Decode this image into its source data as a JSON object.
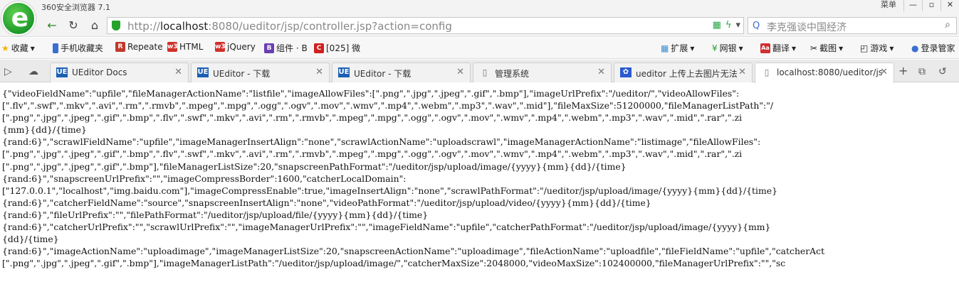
{
  "window": {
    "app_title": "360安全浏览器 7.1",
    "menu_label": "菜单",
    "controls": [
      "—",
      "▫",
      "✕"
    ]
  },
  "navbar": {
    "back_icon": "arrow-left-icon",
    "url_host": "localhost",
    "url_rest": ":8080/ueditor/jsp/controller.jsp?action=config",
    "url_scheme": "http://",
    "search_placeholder": "李克强谈中国经济"
  },
  "bookmarks": [
    {
      "label": "收藏",
      "icon": "star-icon",
      "color": "#f5b400"
    },
    {
      "label": "手机收藏夹",
      "icon": "phone-icon",
      "color": "#3b6fd0"
    },
    {
      "label": "Repeate",
      "icon": "R",
      "color": "#c0392b"
    },
    {
      "label": "HTML",
      "icon": "w3",
      "color": "#d0302b"
    },
    {
      "label": "jQuery",
      "icon": "w3",
      "color": "#d0302b"
    },
    {
      "label": "组件 · B",
      "icon": "B",
      "color": "#6a3fb1"
    },
    {
      "label": "[025] 微",
      "icon": "C",
      "color": "#d02020"
    },
    {
      "label": "扩展",
      "icon": "grid-icon",
      "color": "#3b8fd0"
    },
    {
      "label": "网银",
      "icon": "money-icon",
      "color": "#2a9d3a"
    },
    {
      "label": "翻译",
      "icon": "Aa",
      "color": "#d03030"
    },
    {
      "label": "截图",
      "icon": "scissors-icon",
      "color": "#555555"
    },
    {
      "label": "游戏",
      "icon": "gamepad-icon",
      "color": "#555555"
    },
    {
      "label": "登录管家",
      "icon": "user-icon",
      "color": "#3b6fd0"
    }
  ],
  "tabs": [
    {
      "label": "UEditor Docs",
      "icon": "UE",
      "active": false
    },
    {
      "label": "UEditor - 下载",
      "icon": "UE",
      "active": false
    },
    {
      "label": "UEditor - 下载",
      "icon": "UE",
      "active": false
    },
    {
      "label": "管理系统",
      "icon": "page-icon",
      "active": false
    },
    {
      "label": "ueditor 上传上去图片无法",
      "icon": "baidu-paw-icon",
      "active": false
    },
    {
      "label": "localhost:8080/ueditor/js",
      "icon": "page-icon",
      "active": true
    }
  ],
  "content": {
    "lines": [
      "{\"videoFieldName\":\"upfile\",\"fileManagerActionName\":\"listfile\",\"imageAllowFiles\":[\".png\",\".jpg\",\".jpeg\",\".gif\",\".bmp\"],\"imageUrlPrefix\":\"/ueditor/\",\"videoAllowFiles\":",
      "[\".flv\",\".swf\",\".mkv\",\".avi\",\".rm\",\".rmvb\",\".mpeg\",\".mpg\",\".ogg\",\".ogv\",\".mov\",\".wmv\",\".mp4\",\".webm\",\".mp3\",\".wav\",\".mid\"],\"fileMaxSize\":51200000,\"fileManagerListPath\":\"/",
      "[\".png\",\".jpg\",\".jpeg\",\".gif\",\".bmp\",\".flv\",\".swf\",\".mkv\",\".avi\",\".rm\",\".rmvb\",\".mpeg\",\".mpg\",\".ogg\",\".ogv\",\".mov\",\".wmv\",\".mp4\",\".webm\",\".mp3\",\".wav\",\".mid\",\".rar\",\".zi",
      "{mm}{dd}/{time}",
      "{rand:6}\",\"scrawlFieldName\":\"upfile\",\"imageManagerInsertAlign\":\"none\",\"scrawlActionName\":\"uploadscrawl\",\"imageManagerActionName\":\"listimage\",\"fileAllowFiles\":",
      "[\".png\",\".jpg\",\".jpeg\",\".gif\",\".bmp\",\".flv\",\".swf\",\".mkv\",\".avi\",\".rm\",\".rmvb\",\".mpeg\",\".mpg\",\".ogg\",\".ogv\",\".mov\",\".wmv\",\".mp4\",\".webm\",\".mp3\",\".wav\",\".mid\",\".rar\",\".zi",
      "[\".png\",\".jpg\",\".jpeg\",\".gif\",\".bmp\"],\"fileManagerListSize\":20,\"snapscreenPathFormat\":\"/ueditor/jsp/upload/image/{yyyy}{mm}{dd}/{time}",
      "{rand:6}\",\"snapscreenUrlPrefix\":\"\",\"imageCompressBorder\":1600,\"catcherLocalDomain\":",
      "[\"127.0.0.1\",\"localhost\",\"img.baidu.com\"],\"imageCompressEnable\":true,\"imageInsertAlign\":\"none\",\"scrawlPathFormat\":\"/ueditor/jsp/upload/image/{yyyy}{mm}{dd}/{time}",
      "{rand:6}\",\"catcherFieldName\":\"source\",\"snapscreenInsertAlign\":\"none\",\"videoPathFormat\":\"/ueditor/jsp/upload/video/{yyyy}{mm}{dd}/{time}",
      "{rand:6}\",\"fileUrlPrefix\":\"\",\"filePathFormat\":\"/ueditor/jsp/upload/file/{yyyy}{mm}{dd}/{time}",
      "{rand:6}\",\"catcherUrlPrefix\":\"\",\"scrawlUrlPrefix\":\"\",\"imageManagerUrlPrefix\":\"\",\"imageFieldName\":\"upfile\",\"catcherPathFormat\":\"/ueditor/jsp/upload/image/{yyyy}{mm}",
      "{dd}/{time}",
      "{rand:6}\",\"imageActionName\":\"uploadimage\",\"imageManagerListSize\":20,\"snapscreenActionName\":\"uploadimage\",\"fileActionName\":\"uploadfile\",\"fileFieldName\":\"upfile\",\"catcherAct",
      "[\".png\",\".jpg\",\".jpeg\",\".gif\",\".bmp\"],\"imageManagerListPath\":\"/ueditor/jsp/upload/image/\",\"catcherMaxSize\":2048000,\"videoMaxSize\":102400000,\"fileManagerUrlPrefix\":\"\",\"sc"
    ]
  }
}
